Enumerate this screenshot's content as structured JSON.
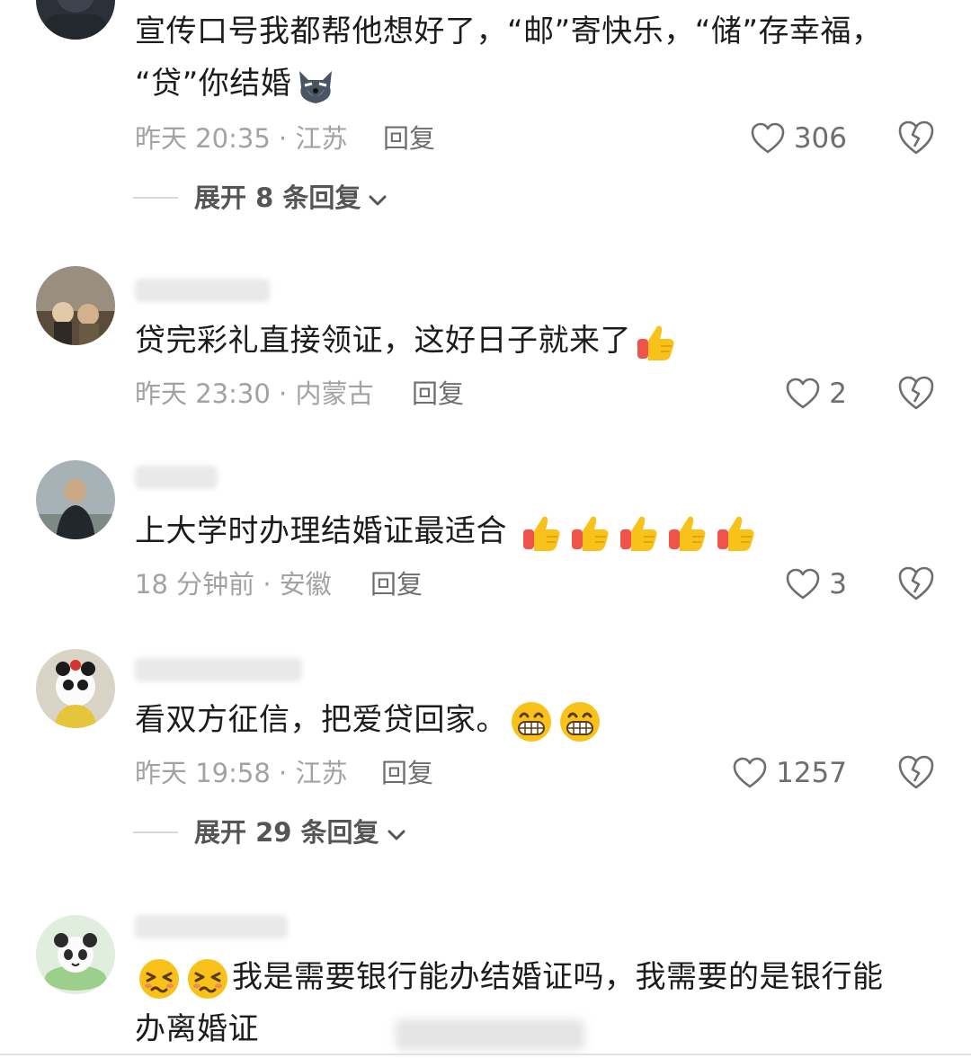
{
  "comments": [
    {
      "text_line1": "宣传口号我都帮他想好了，“邮”寄快乐，“储”存幸福，",
      "text_line2": "“贷”你结婚",
      "emoji": "wolf-face-emoji",
      "time_location": "昨天 20:35 · 江苏",
      "reply_label": "回复",
      "likes": "306",
      "expand_label": "展开 8 条回复"
    },
    {
      "text": "贷完彩礼直接领证，这好日子就来了",
      "emoji": "thumbs-up-emoji",
      "time_location": "昨天 23:30 · 内蒙古",
      "reply_label": "回复",
      "likes": "2"
    },
    {
      "text": "上大学时办理结婚证最适合",
      "emoji": "thumbs-up-emoji",
      "emoji_count": 5,
      "time_location": "18 分钟前 · 安徽",
      "reply_label": "回复",
      "likes": "3"
    },
    {
      "text": "看双方征信，把爱贷回家。",
      "emoji": "grinning-face-emoji",
      "emoji_count": 2,
      "time_location": "昨天 19:58 · 江苏",
      "reply_label": "回复",
      "likes": "1257",
      "expand_label": "展开 29 条回复"
    },
    {
      "emoji": "persevering-face-emoji",
      "emoji_count": 2,
      "text_line1": "我是需要银行能办结婚证吗，我需要的是银行能",
      "text_line2": "办离婚证"
    }
  ],
  "icons": {
    "like": "heart-outline-icon",
    "dislike": "broken-heart-icon",
    "expand": "chevron-down-icon"
  },
  "colors": {
    "meta_text": "#a2a2a2",
    "action_text": "#6e6e6e",
    "body_text": "#1c1c1c",
    "thumb_yellow": "#f9c21a",
    "thumb_red": "#f0534a"
  }
}
